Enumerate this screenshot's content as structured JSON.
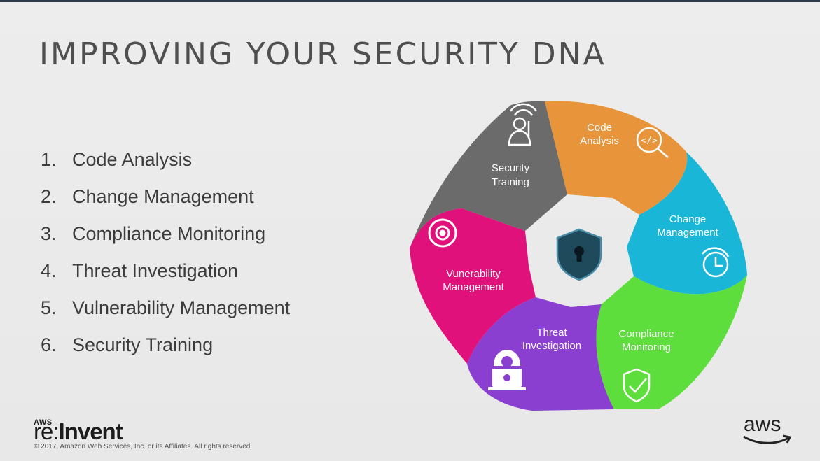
{
  "slide": {
    "title": "IMPROVING YOUR SECURITY DNA",
    "list": [
      {
        "num": "1.",
        "text": "Code Analysis"
      },
      {
        "num": "2.",
        "text": "Change Management"
      },
      {
        "num": "3.",
        "text": "Compliance Monitoring"
      },
      {
        "num": "4.",
        "text": "Threat Investigation"
      },
      {
        "num": "5.",
        "text": "Vulnerability Management"
      },
      {
        "num": "6.",
        "text": "Security Training"
      }
    ]
  },
  "diagram": {
    "segments": [
      {
        "line1": "Code",
        "line2": "Analysis",
        "color": "#e7943a",
        "icon": "code-search-icon"
      },
      {
        "line1": "Change",
        "line2": "Management",
        "color": "#19b6d8",
        "icon": "clock-refresh-icon"
      },
      {
        "line1": "Compliance",
        "line2": "Monitoring",
        "color": "#5ede3c",
        "icon": "shield-check-icon"
      },
      {
        "line1": "Threat",
        "line2": "Investigation",
        "color": "#8a3fd1",
        "icon": "hacker-laptop-icon"
      },
      {
        "line1": "Vunerability",
        "line2": "Management",
        "color": "#e0117a",
        "icon": "target-icon"
      },
      {
        "line1": "Security",
        "line2": "Training",
        "color": "#6b6b6b",
        "icon": "trainer-icon"
      }
    ],
    "center_icon": "shield-lock-icon",
    "center_color": "#1f4a5c"
  },
  "footer": {
    "brand_small": "AWS",
    "brand_re": "re:",
    "brand_invent": "Invent",
    "copyright": "© 2017, Amazon Web Services, Inc. or its Affiliates. All rights reserved.",
    "aws_logo": "aws"
  }
}
